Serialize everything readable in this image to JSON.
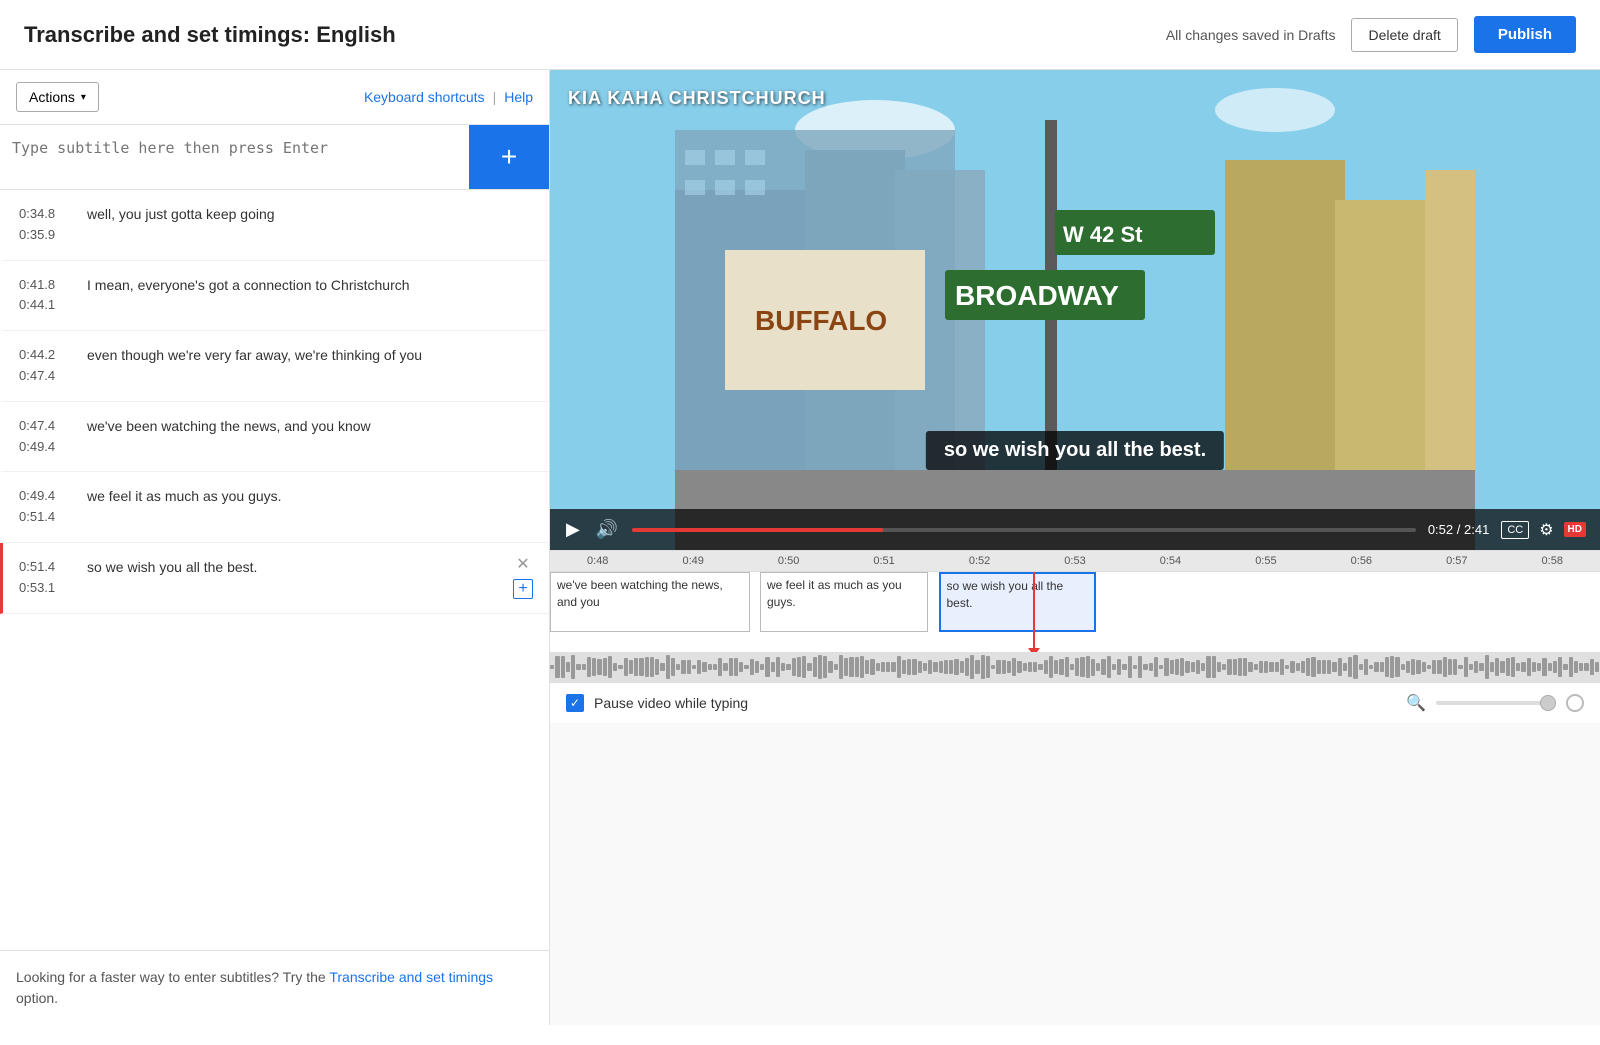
{
  "header": {
    "title": "Transcribe and set timings: English",
    "saved_status": "All changes saved in Drafts",
    "delete_label": "Delete draft",
    "publish_label": "Publish"
  },
  "left_toolbar": {
    "actions_label": "Actions",
    "keyboard_shortcuts_label": "Keyboard shortcuts",
    "help_label": "Help"
  },
  "subtitle_input": {
    "placeholder": "Type subtitle here then press Enter"
  },
  "subtitles": [
    {
      "start": "0:34.8",
      "end": "0:35.9",
      "text": "well, you just gotta keep going",
      "active": false
    },
    {
      "start": "0:41.8",
      "end": "0:44.1",
      "text": "I mean, everyone's got a connection to Christchurch",
      "active": false
    },
    {
      "start": "0:44.2",
      "end": "0:47.4",
      "text": "even though we're very far away, we're thinking of you",
      "active": false
    },
    {
      "start": "0:47.4",
      "end": "0:49.4",
      "text": "we've been watching the news, and you know",
      "active": false
    },
    {
      "start": "0:49.4",
      "end": "0:51.4",
      "text": "we feel it as much as you guys.",
      "active": false
    },
    {
      "start": "0:51.4",
      "end": "0:53.1",
      "text": "so we wish you all the best.",
      "active": true
    }
  ],
  "bottom_hint": {
    "prefix": "Looking for a faster way to enter subtitles? Try the ",
    "link_text": "Transcribe and set timings",
    "suffix": " option."
  },
  "video": {
    "overlay_title": "KIA KAHA CHRISTCHURCH",
    "subtitle_text": "so we wish you all the best.",
    "time_current": "0:52",
    "time_total": "2:41",
    "cc_label": "CC",
    "hd_label": "HD"
  },
  "timeline": {
    "ticks": [
      "0:48",
      "0:49",
      "0:50",
      "0:51",
      "0:52",
      "0:53",
      "0:54",
      "0:55",
      "0:56",
      "0:57",
      "0:58"
    ],
    "clips": [
      {
        "text": "we've been watching the news, and you",
        "left_pct": 0,
        "width_pct": 18
      },
      {
        "text": "we feel it as much as you guys.",
        "left_pct": 19,
        "width_pct": 17,
        "active": false
      },
      {
        "text": "so we wish you all the best.",
        "left_pct": 37,
        "width_pct": 15,
        "active": true
      }
    ]
  },
  "bottom_bar": {
    "pause_label": "Pause video while typing"
  }
}
